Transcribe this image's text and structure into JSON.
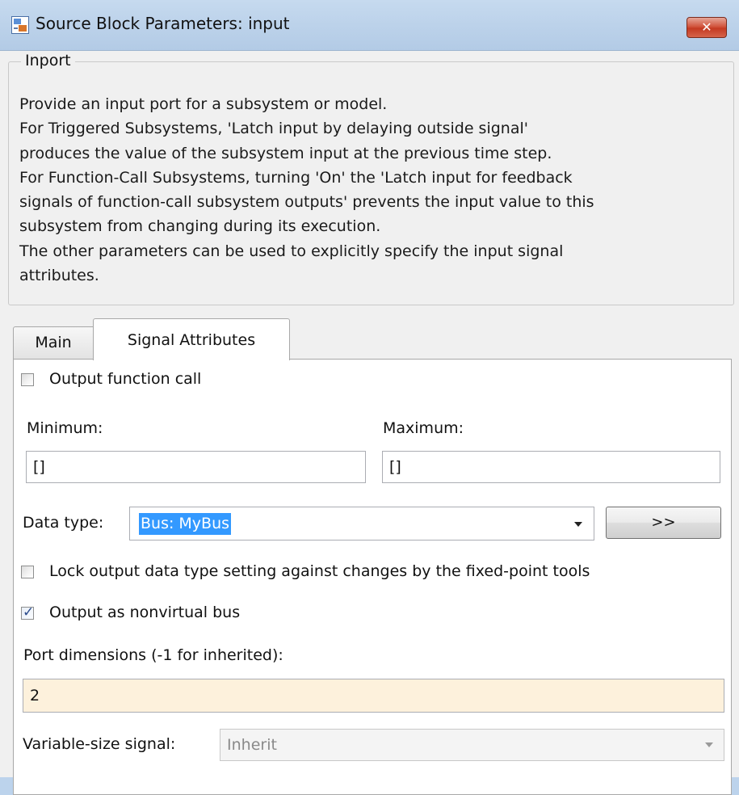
{
  "window": {
    "title": "Source Block Parameters: input",
    "close_label": "✕"
  },
  "group": {
    "title": "Inport",
    "description_lines": [
      "Provide an input port for a subsystem or model.",
      "For Triggered Subsystems, 'Latch input by delaying outside signal'",
      "produces the value of the subsystem input at the previous time step.",
      "For Function-Call Subsystems, turning 'On' the 'Latch input for feedback",
      "signals of function-call subsystem outputs' prevents the input value to this",
      "subsystem from changing during its execution.",
      "The other parameters can be used to explicitly specify the input signal",
      "attributes."
    ]
  },
  "tabs": [
    {
      "label": "Main",
      "active": false
    },
    {
      "label": "Signal Attributes",
      "active": true
    }
  ],
  "signal_attributes": {
    "output_function_call": {
      "label": "Output function call",
      "checked": false
    },
    "minimum": {
      "label": "Minimum:",
      "value": "[]"
    },
    "maximum": {
      "label": "Maximum:",
      "value": "[]"
    },
    "data_type": {
      "label": "Data type:",
      "value": "Bus: MyBus",
      "assistant_button": ">>"
    },
    "lock_output": {
      "label": "Lock output data type setting against changes by the fixed-point tools",
      "checked": false
    },
    "nonvirtual_bus": {
      "label": "Output as nonvirtual bus",
      "checked": true
    },
    "port_dimensions": {
      "label": "Port dimensions (-1 for inherited):",
      "value": "2"
    },
    "variable_size": {
      "label": "Variable-size signal:",
      "value": "Inherit",
      "enabled": false
    }
  },
  "colors": {
    "titlebar": "#bcd2ea",
    "close_button": "#c43a22",
    "selection": "#3399ff",
    "port_dim_bg": "#fdf1dc",
    "disabled_text": "#8a8a8a"
  },
  "icons": {
    "app_icon": "simulink-block-icon",
    "close": "close-icon",
    "dropdown": "chevron-down-icon",
    "checkmark": "checkmark-icon"
  }
}
